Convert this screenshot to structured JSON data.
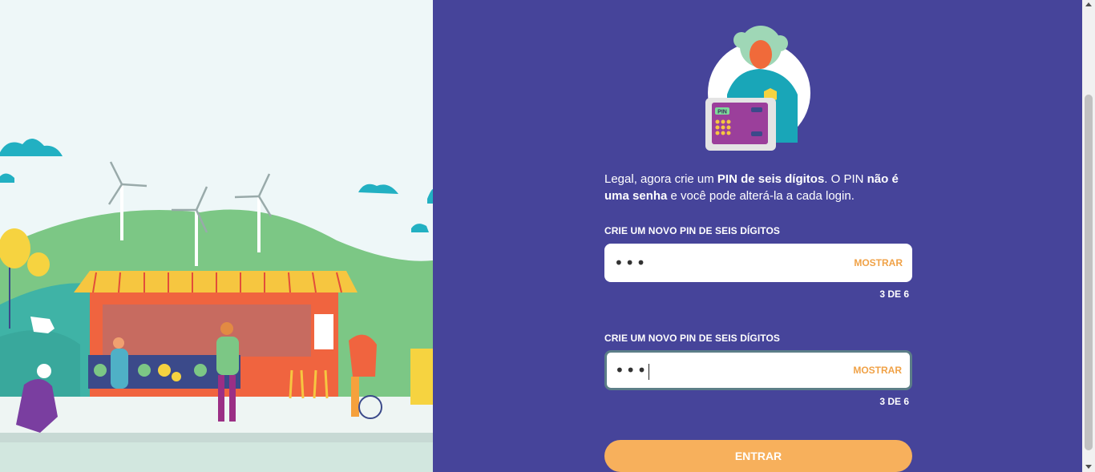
{
  "intro": {
    "part1": "Legal, agora crie um ",
    "bold1": "PIN de seis dígitos",
    "part2": ". O PIN ",
    "bold2": "não é uma senha",
    "part3": " e você pode alterá-la a cada login."
  },
  "illustration": {
    "safe_label": "PIN"
  },
  "fields": [
    {
      "label": "CRIE UM NOVO PIN DE SEIS DÍGITOS",
      "value": "•••",
      "show_label": "MOSTRAR",
      "counter": "3 DE 6"
    },
    {
      "label": "CRIE UM NOVO PIN DE SEIS DÍGITOS",
      "value": "•••",
      "show_label": "MOSTRAR",
      "counter": "3 DE 6"
    }
  ],
  "submit_label": "ENTRAR",
  "colors": {
    "panel": "#46449a",
    "accent": "#f7b05c",
    "link": "#f0a247"
  }
}
